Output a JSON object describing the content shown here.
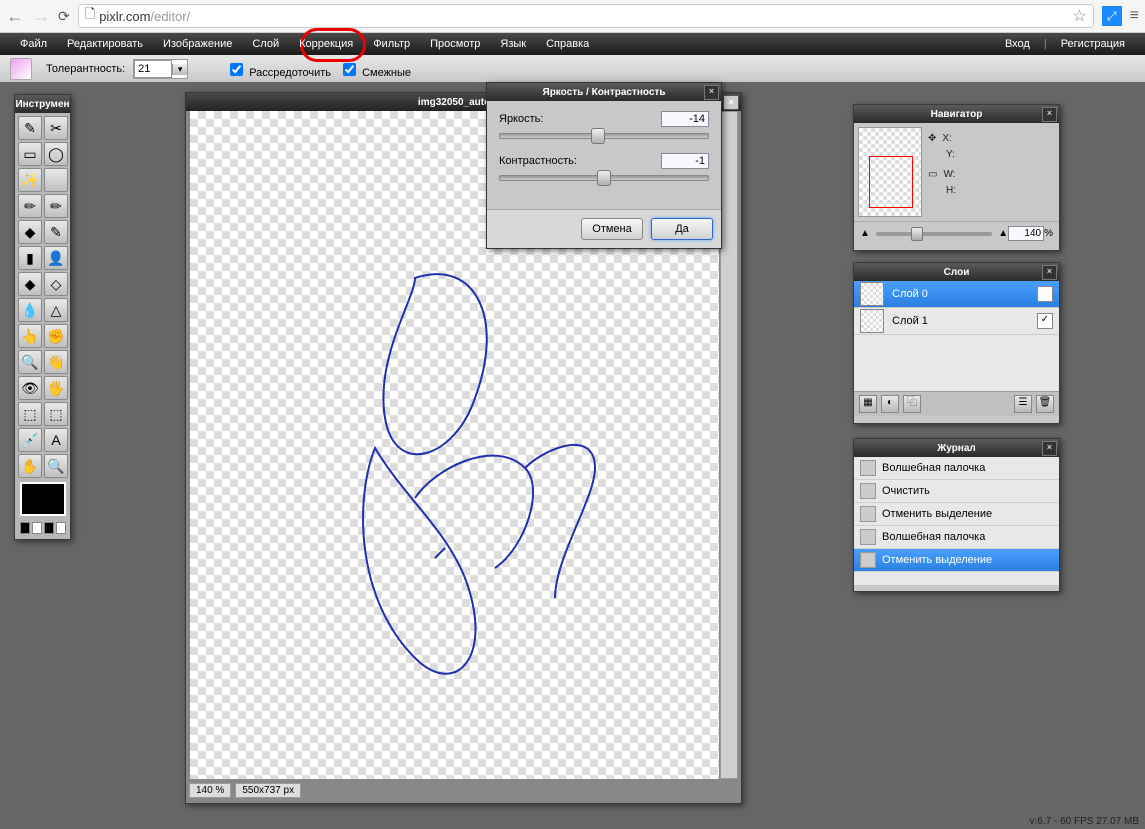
{
  "browser": {
    "url_host": "pixlr.com",
    "url_path": "/editor/"
  },
  "menu": {
    "items": [
      "Файл",
      "Редактировать",
      "Изображение",
      "Слой",
      "Коррекция",
      "Фильтр",
      "Просмотр",
      "Язык",
      "Справка"
    ],
    "login": "Вход",
    "register": "Регистрация",
    "sep": "|"
  },
  "options": {
    "tolerance_label": "Толерантность:",
    "tolerance_value": "21",
    "scatter_label": "Рассредоточить",
    "contiguous_label": "Смежные"
  },
  "tools_title": "Инструмен",
  "tool_icons": [
    "✎",
    "✂",
    "▭",
    "◯",
    "✨",
    "",
    "✏",
    "✏",
    "◆",
    "✎",
    "▮",
    "👤",
    "◆",
    "◇",
    "💧",
    "△",
    "👆",
    "✊",
    "🔍",
    "👋",
    "👁",
    "🖐",
    "⬚",
    "⬚",
    "💉",
    "A",
    "✋",
    "🔍"
  ],
  "document": {
    "title": "img32050_autograf",
    "zoom": "140 %",
    "dims": "550x737 px"
  },
  "dialog": {
    "title": "Яркость / Контрастность",
    "brightness_label": "Яркость:",
    "brightness_value": "-14",
    "contrast_label": "Контрастность:",
    "contrast_value": "-1",
    "cancel": "Отмена",
    "ok": "Да"
  },
  "navigator": {
    "title": "Навигатор",
    "x": "X:",
    "y": "Y:",
    "w": "W:",
    "h": "H:",
    "zoom": "140",
    "pct": "%"
  },
  "layers": {
    "title": "Слои",
    "items": [
      {
        "name": "Слой 0",
        "sel": true
      },
      {
        "name": "Слой 1",
        "sel": false
      }
    ]
  },
  "history": {
    "title": "Журнал",
    "items": [
      {
        "name": "Волшебная палочка"
      },
      {
        "name": "Очистить"
      },
      {
        "name": "Отменить выделение"
      },
      {
        "name": "Волшебная палочка"
      },
      {
        "name": "Отменить выделение",
        "sel": true
      }
    ]
  },
  "footer": "v:6.7 - 60 FPS 27.07 MB"
}
